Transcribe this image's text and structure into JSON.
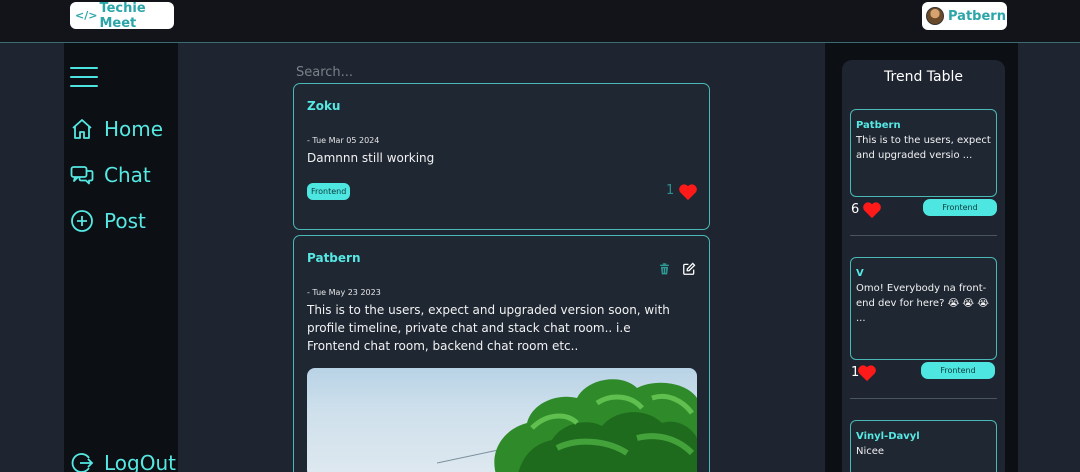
{
  "header": {
    "brand_icon": "</>",
    "brand_name": "Techie Meet",
    "username": "Patbern"
  },
  "sidebar": {
    "items": [
      {
        "label": "Home",
        "icon": "home-icon"
      },
      {
        "label": "Chat",
        "icon": "chat-icon"
      },
      {
        "label": "Post",
        "icon": "plus-circle-icon"
      }
    ],
    "logout_label": "LogOut"
  },
  "search": {
    "placeholder": "Search..."
  },
  "feed": {
    "posts": [
      {
        "author": "Zoku",
        "date": "- Tue Mar 05 2024",
        "text": "Damnnn still working",
        "tag": "Frontend",
        "likes": "1"
      },
      {
        "author": "Patbern",
        "date": "- Tue May 23 2023",
        "text": "This is to the users, expect and upgraded version soon, with profile timeline, private chat and stack chat room.. i.e Frontend chat room, backend chat room etc.."
      }
    ]
  },
  "trend": {
    "title": "Trend Table",
    "items": [
      {
        "author": "Patbern",
        "text": "This is to the users, expect and upgraded versio ...",
        "likes": "6",
        "tag": "Frontend"
      },
      {
        "author": "V",
        "text": "Omo! Everybody na front-end dev for here? 😭 😭 😭 ...",
        "likes": "1",
        "tag": "Frontend"
      },
      {
        "author": "Vinyl-Davyl",
        "text": "Nicee"
      }
    ]
  },
  "colors": {
    "accent": "#56e8e3",
    "heart": "#ff1a1a",
    "tag_bg": "#4de6e1"
  }
}
